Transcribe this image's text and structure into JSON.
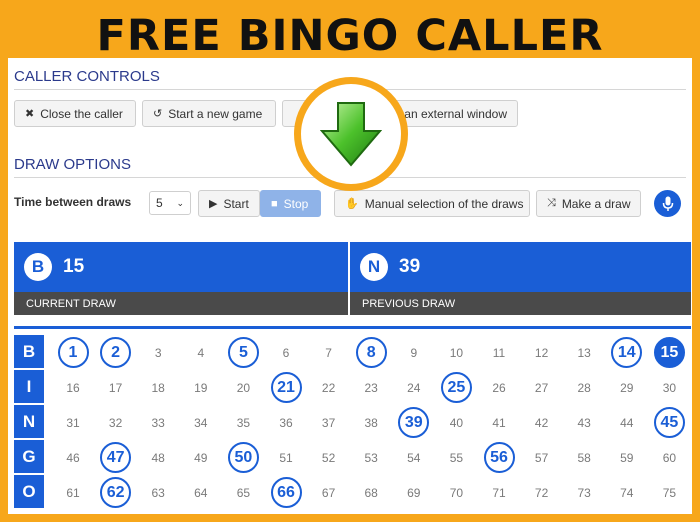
{
  "headline": "FREE BINGO CALLER",
  "caller_controls": {
    "title": "CALLER CONTROLS",
    "close_label": "Close the caller",
    "new_game_label": "Start a new game",
    "external_window_label": "an external window"
  },
  "draw_options": {
    "title": "DRAW OPTIONS",
    "time_label": "Time between draws",
    "time_value": "5",
    "start_label": "Start",
    "stop_label": "Stop",
    "manual_label": "Manual selection of the draws",
    "make_draw_label": "Make a draw"
  },
  "current_draw": {
    "letter": "B",
    "number": "15",
    "caption": "CURRENT DRAW"
  },
  "previous_draw": {
    "letter": "N",
    "number": "39",
    "caption": "PREVIOUS DRAW"
  },
  "board": {
    "rows": [
      {
        "letter": "B",
        "cells": [
          "1",
          "2",
          "3",
          "4",
          "5",
          "6",
          "7",
          "8",
          "9",
          "10",
          "11",
          "12",
          "13",
          "14",
          "15"
        ]
      },
      {
        "letter": "I",
        "cells": [
          "16",
          "17",
          "18",
          "19",
          "20",
          "21",
          "22",
          "23",
          "24",
          "25",
          "26",
          "27",
          "28",
          "29",
          "30"
        ]
      },
      {
        "letter": "N",
        "cells": [
          "31",
          "32",
          "33",
          "34",
          "35",
          "36",
          "37",
          "38",
          "39",
          "40",
          "41",
          "42",
          "43",
          "44",
          "45"
        ]
      },
      {
        "letter": "G",
        "cells": [
          "46",
          "47",
          "48",
          "49",
          "50",
          "51",
          "52",
          "53",
          "54",
          "55",
          "56",
          "57",
          "58",
          "59",
          "60"
        ]
      },
      {
        "letter": "O",
        "cells": [
          "61",
          "62",
          "63",
          "64",
          "65",
          "66",
          "67",
          "68",
          "69",
          "70",
          "71",
          "72",
          "73",
          "74",
          "75"
        ]
      }
    ],
    "called": [
      "1",
      "2",
      "5",
      "8",
      "14",
      "15",
      "21",
      "25",
      "39",
      "45",
      "47",
      "50",
      "56",
      "62",
      "66"
    ],
    "latest": "15"
  },
  "colors": {
    "accent": "#1a5ed6",
    "frame": "#f7a71b",
    "caption_bg": "#4a4a4a",
    "arrow": "#4cc12b"
  },
  "icons": {
    "close": "x-icon",
    "new_game": "reset-icon",
    "start": "play-icon",
    "stop": "stop-icon",
    "manual": "hand-icon",
    "make_draw": "shuffle-icon",
    "mic": "microphone-icon",
    "overlay": "green-down-arrow-icon"
  }
}
